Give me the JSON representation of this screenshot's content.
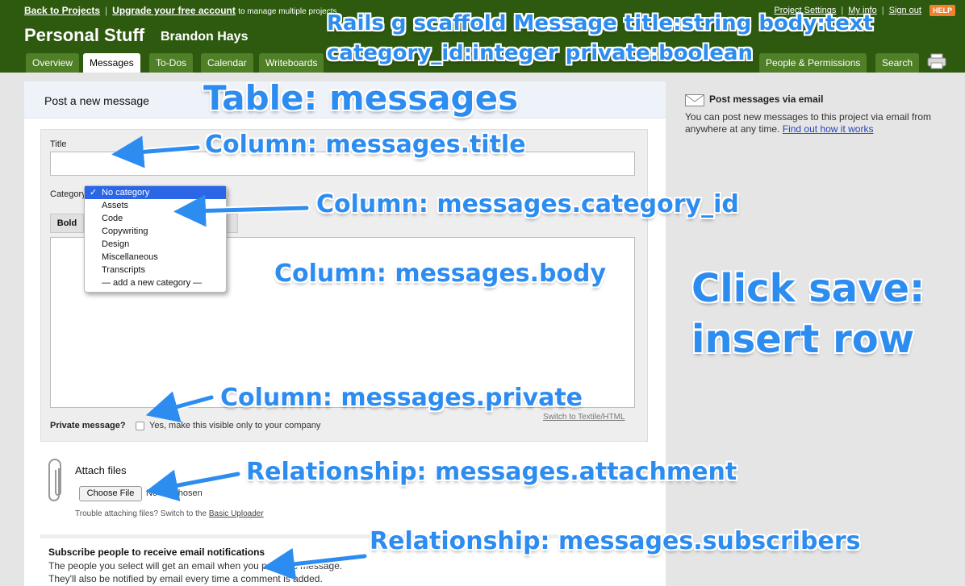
{
  "topbar": {
    "back_link": "Back to Projects",
    "upgrade_link": "Upgrade your free account",
    "upgrade_suffix": "to manage multiple projects",
    "project_settings": "Project Settings",
    "my_info": "My info",
    "sign_out": "Sign out",
    "help": "HELP"
  },
  "project": {
    "title": "Personal Stuff",
    "owner": "Brandon Hays"
  },
  "tabs": [
    "Overview",
    "Messages",
    "To-Dos",
    "Calendar",
    "Writeboards",
    "People & Permissions",
    "Search"
  ],
  "active_tab": "Messages",
  "panel": {
    "title": "Post a new message",
    "title_label": "Title",
    "category_label": "Category",
    "bold_button": "Bold",
    "switch_textile": "Switch to Textile/HTML",
    "private_label": "Private message?",
    "private_text": "Yes, make this visible only to your company",
    "attach_label": "Attach files",
    "choose_file": "Choose File",
    "no_file": "No file chosen",
    "trouble_prefix": "Trouble attaching files? Switch to the",
    "trouble_link": "Basic Uploader",
    "subscribe_title": "Subscribe people to receive email notifications",
    "subscribe_line1": "The people you select will get an email when you post this message.",
    "subscribe_line2": "They'll also be notified by email every time a comment is added."
  },
  "category_dropdown": {
    "selected": "No category",
    "options": [
      "No category",
      "Assets",
      "Code",
      "Copywriting",
      "Design",
      "Miscellaneous",
      "Transcripts",
      "— add a new category —"
    ]
  },
  "sidebar": {
    "email_title": "Post messages via email",
    "email_desc": "You can post new messages to this project via email from anywhere at any time.",
    "email_link": "Find out how it works"
  },
  "annotations": {
    "scaffold_line1": "Rails g scaffold Message title:string body:text",
    "scaffold_line2": "category_id:integer private:boolean",
    "table": "Table: messages",
    "col_title": "Column: messages.title",
    "col_category": "Column: messages.category_id",
    "col_body": "Column: messages.body",
    "col_private": "Column: messages.private",
    "rel_attachment": "Relationship: messages.attachment",
    "rel_subscribers": "Relationship: messages.subscribers",
    "click_save_line1": "Click save:",
    "click_save_line2": "insert row"
  },
  "colors": {
    "header_green": "#2e5a0f",
    "tab_green": "#4f7f27",
    "annotation_blue": "#2d8cf0",
    "select_blue": "#2b66e7"
  }
}
